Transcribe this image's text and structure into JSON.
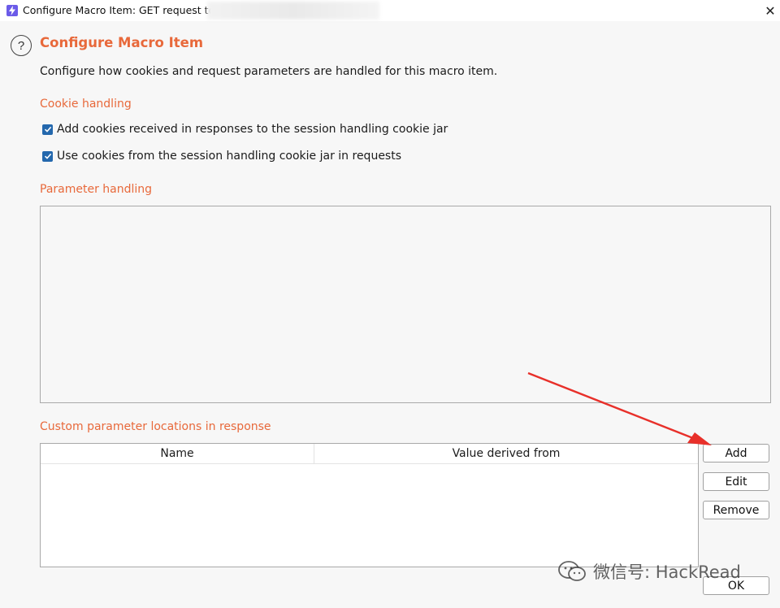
{
  "window": {
    "title": "Configure Macro Item: GET request to h",
    "close_glyph": "✕"
  },
  "header": {
    "help_glyph": "?",
    "title": "Configure Macro Item",
    "description": "Configure how cookies and request parameters are handled for this macro item."
  },
  "cookie_handling": {
    "heading": "Cookie handling",
    "options": [
      {
        "label": "Add cookies received in responses to the session handling cookie jar",
        "checked": true
      },
      {
        "label": "Use cookies from the session handling cookie jar in requests",
        "checked": true
      }
    ]
  },
  "parameter_handling": {
    "heading": "Parameter handling"
  },
  "custom_locations": {
    "heading": "Custom parameter locations in response",
    "columns": [
      "Name",
      "Value derived from"
    ],
    "rows": []
  },
  "buttons": {
    "add": "Add",
    "edit": "Edit",
    "remove": "Remove",
    "ok": "OK"
  },
  "watermark": {
    "text": "微信号: HackRead"
  },
  "colors": {
    "accent": "#e8693b",
    "checkbox": "#2468ad",
    "annotation_arrow": "#e8302a"
  },
  "icons": {
    "app": "lightning-icon",
    "help": "question-circle-icon",
    "close": "close-icon",
    "checkbox": "checkmark-icon",
    "watermark": "wechat-icon"
  }
}
